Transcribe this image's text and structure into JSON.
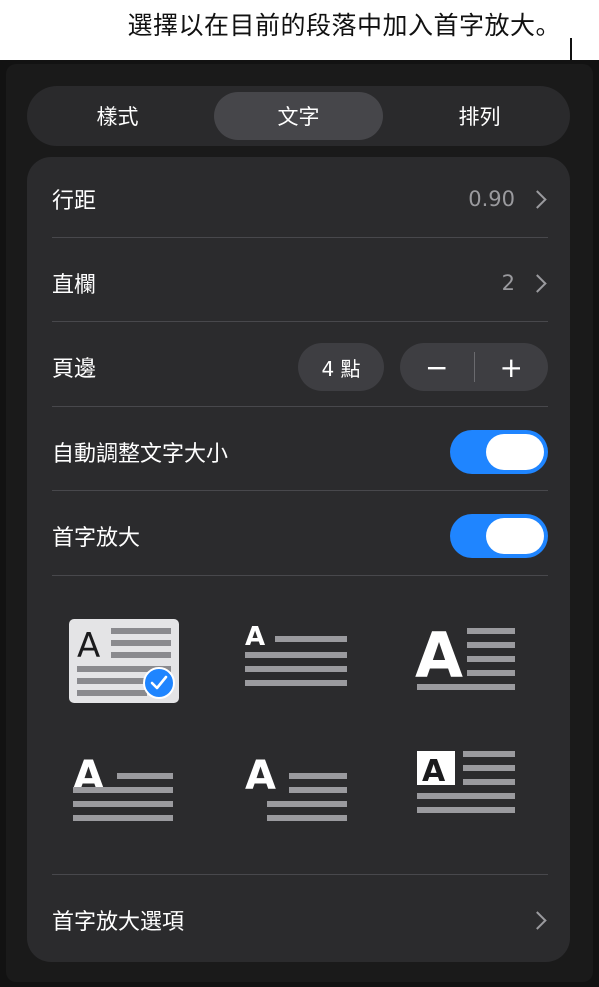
{
  "callout": {
    "text": "選擇以在目前的段落中加入首字放大。"
  },
  "tabs": [
    {
      "label": "樣式",
      "active": false
    },
    {
      "label": "文字",
      "active": true
    },
    {
      "label": "排列",
      "active": false
    }
  ],
  "rows": {
    "line_spacing": {
      "label": "行距",
      "value": "0.90"
    },
    "columns": {
      "label": "直欄",
      "value": "2"
    },
    "margin": {
      "label": "頁邊",
      "amount": "4 點",
      "minus": "−",
      "plus": "+"
    },
    "autoshrink": {
      "label": "自動調整文字大小",
      "on": true
    },
    "drop_cap": {
      "label": "首字放大",
      "on": true
    },
    "drop_cap_options": {
      "label": "首字放大選項"
    }
  },
  "drop_cap_styles": {
    "letter": "A",
    "selected_index": 0,
    "count": 6
  },
  "colors": {
    "accent": "#1f85ff",
    "panel": "#2b2b2d",
    "text": "#ffffff",
    "secondary": "#9a9a9e"
  }
}
